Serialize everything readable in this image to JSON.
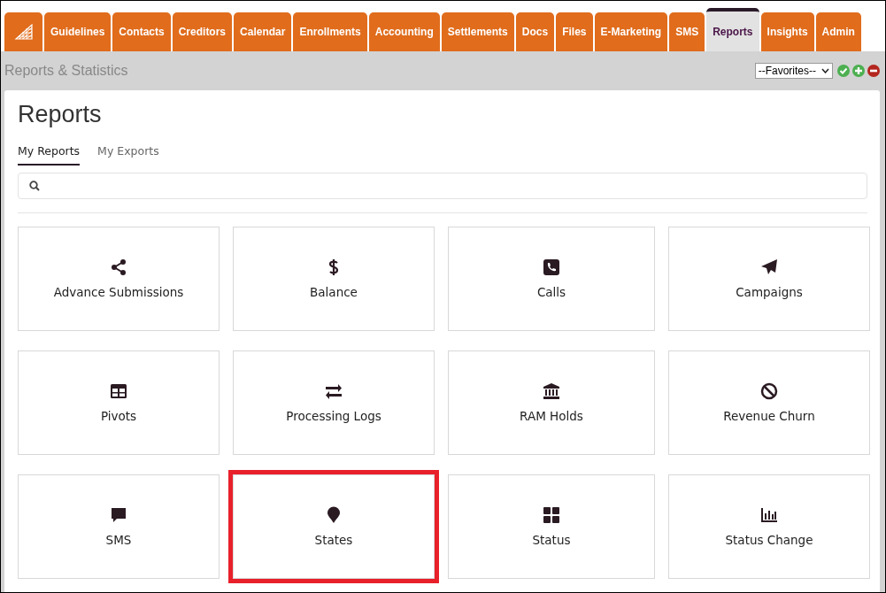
{
  "nav": {
    "tabs": [
      {
        "label": "Guidelines",
        "selected": false
      },
      {
        "label": "Contacts",
        "selected": false
      },
      {
        "label": "Creditors",
        "selected": false
      },
      {
        "label": "Calendar",
        "selected": false
      },
      {
        "label": "Enrollments",
        "selected": false
      },
      {
        "label": "Accounting",
        "selected": false
      },
      {
        "label": "Settlements",
        "selected": false
      },
      {
        "label": "Docs",
        "selected": false
      },
      {
        "label": "Files",
        "selected": false
      },
      {
        "label": "E-Marketing",
        "selected": false
      },
      {
        "label": "SMS",
        "selected": false
      },
      {
        "label": "Reports",
        "selected": true
      },
      {
        "label": "Insights",
        "selected": false
      },
      {
        "label": "Admin",
        "selected": false
      }
    ]
  },
  "header": {
    "title": "Reports & Statistics",
    "favorites": "--Favorites--"
  },
  "panel": {
    "title": "Reports",
    "tabs": [
      {
        "label": "My Reports",
        "selected": true
      },
      {
        "label": "My Exports",
        "selected": false
      }
    ],
    "cards": [
      {
        "label": "Advance Submissions",
        "highlighted": false
      },
      {
        "label": "Balance",
        "highlighted": false
      },
      {
        "label": "Calls",
        "highlighted": false
      },
      {
        "label": "Campaigns",
        "highlighted": false
      },
      {
        "label": "Pivots",
        "highlighted": false
      },
      {
        "label": "Processing Logs",
        "highlighted": false
      },
      {
        "label": "RAM Holds",
        "highlighted": false
      },
      {
        "label": "Revenue Churn",
        "highlighted": false
      },
      {
        "label": "SMS",
        "highlighted": false
      },
      {
        "label": "States",
        "highlighted": true
      },
      {
        "label": "Status",
        "highlighted": false
      },
      {
        "label": "Status Change",
        "highlighted": false
      }
    ]
  }
}
